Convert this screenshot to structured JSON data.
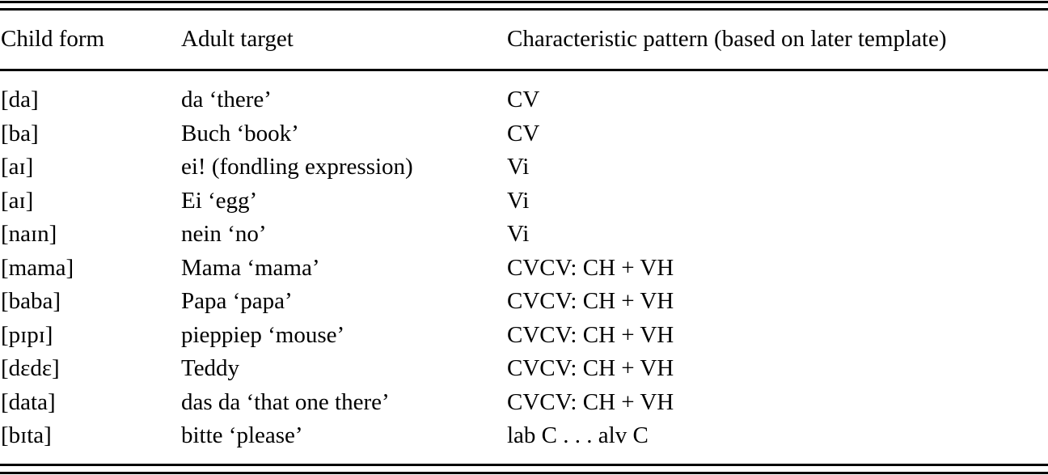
{
  "table": {
    "columns": [
      "Child form",
      "Adult target",
      "Characteristic pattern (based on later template)"
    ],
    "rows": [
      [
        "[da]",
        "da ‘there’",
        "CV"
      ],
      [
        "[ba]",
        "Buch ‘book’",
        "CV"
      ],
      [
        "[aɪ]",
        "ei! (fondling expression)",
        "Vi"
      ],
      [
        "[aɪ]",
        "Ei ‘egg’",
        "Vi"
      ],
      [
        "[naɪn]",
        "nein ‘no’",
        "Vi"
      ],
      [
        "[mama]",
        "Mama ‘mama’",
        "CVCV: CH + VH"
      ],
      [
        "[baba]",
        "Papa ‘papa’",
        "CVCV: CH + VH"
      ],
      [
        "[pɪpɪ]",
        "pieppiep ‘mouse’",
        "CVCV: CH + VH"
      ],
      [
        "[dɛdɛ]",
        "Teddy",
        "CVCV: CH + VH"
      ],
      [
        "[data]",
        "das da ‘that one there’",
        "CVCV: CH + VH"
      ],
      [
        "[bɪta]",
        "bitte ‘please’",
        "lab C . . . alv C"
      ]
    ]
  }
}
